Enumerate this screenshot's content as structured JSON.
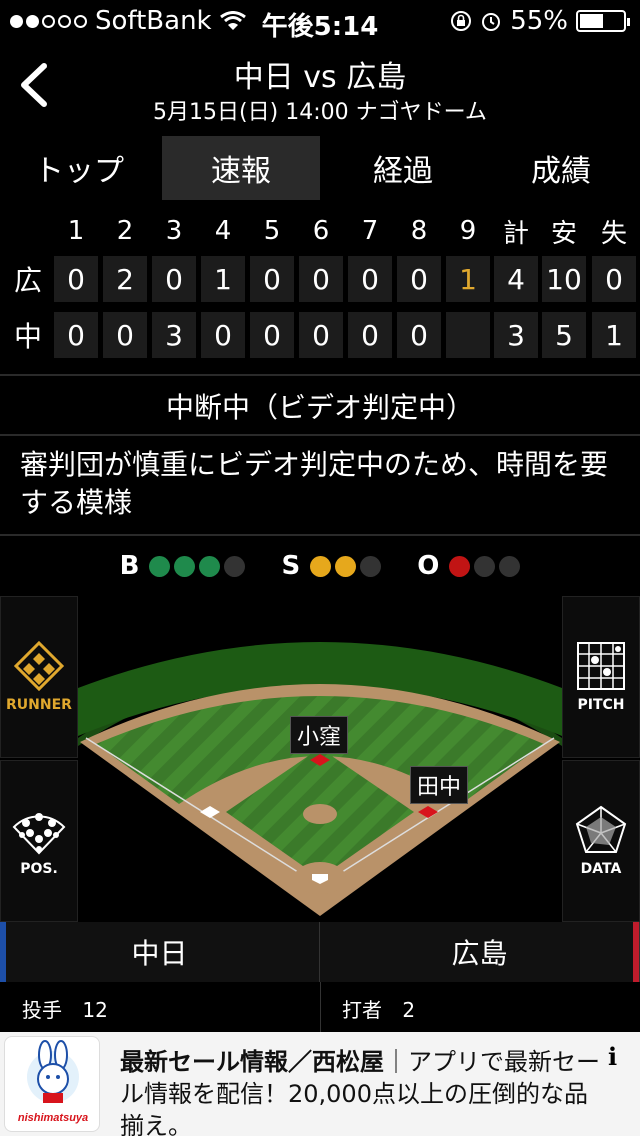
{
  "status_bar": {
    "carrier": "SoftBank",
    "time": "午後5:14",
    "battery": "55%",
    "battery_level": 0.55
  },
  "header": {
    "title": "中日 vs 広島",
    "subtitle": "5月15日(日) 14:00 ナゴヤドーム"
  },
  "tabs": [
    "トップ",
    "速報",
    "経過",
    "成績"
  ],
  "scoreboard": {
    "columns": [
      "1",
      "2",
      "3",
      "4",
      "5",
      "6",
      "7",
      "8",
      "9",
      "計",
      "安",
      "失"
    ],
    "rows": [
      {
        "team": "広",
        "cells": [
          "0",
          "2",
          "0",
          "1",
          "0",
          "0",
          "0",
          "0",
          "1",
          "4",
          "10",
          "0"
        ]
      },
      {
        "team": "中",
        "cells": [
          "0",
          "0",
          "3",
          "0",
          "0",
          "0",
          "0",
          "0",
          "",
          "3",
          "5",
          "1"
        ]
      }
    ]
  },
  "status": {
    "title": "中断中（ビデオ判定中）",
    "message": "審判団が慎重にビデオ判定中のため、時間を要する模様"
  },
  "count": {
    "b_label": "B",
    "s_label": "S",
    "o_label": "O",
    "balls": 3,
    "strikes": 2,
    "outs": 1
  },
  "field": {
    "players": [
      "小窪",
      "田中"
    ],
    "buttons": {
      "runner": "RUNNER",
      "pitch": "PITCH",
      "pos": "POS.",
      "data": "DATA"
    }
  },
  "teams": {
    "left": "中日",
    "right": "広島",
    "left_player": {
      "role": "投手",
      "number": "12"
    },
    "right_player": {
      "role": "打者",
      "number": "2"
    }
  },
  "ad": {
    "headline": "最新セール情報／西松屋",
    "body": "｜アプリで最新セール情報を配信！20,000点以上の圧倒的な品揃え。",
    "logo_text": "nishimatsuya",
    "info": "i"
  },
  "colors": {
    "ball": "#1f8a4c",
    "strike": "#e6a81c",
    "out": "#c11414",
    "highlight": "#e0a82e"
  }
}
